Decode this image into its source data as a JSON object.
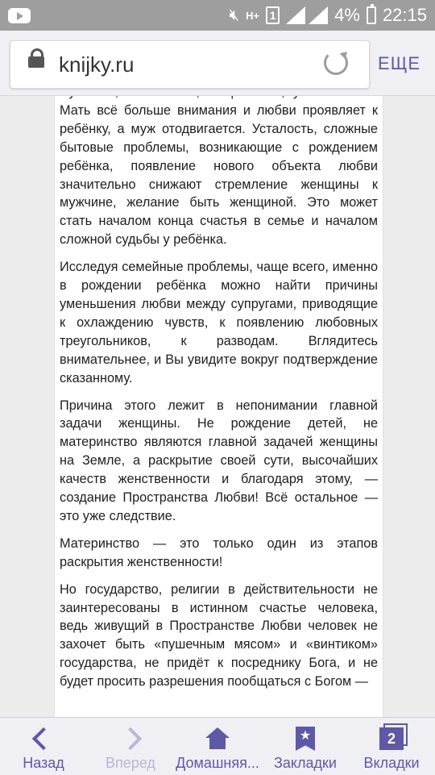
{
  "status_bar": {
    "battery": "4%",
    "time": "22:15",
    "network": "H+",
    "sim": "1"
  },
  "browser": {
    "url": "knijky.ru",
    "more_label": "ЕЩЕ"
  },
  "article": {
    "paragraphs": [
      "мужчины, но любовь, чаще всего, уменьшается. Мать всё больше внимания и любви проявляет к ребёнку, а муж отодвигается. Усталость, сложные бытовые проблемы, возникающие с рождением ребёнка, появление нового объекта любви значительно снижают стремление женщины к мужчине, желание быть женщиной. Это может стать началом конца счастья в семье и началом сложной судьбы у ребёнка.",
      "Исследуя семейные проблемы, чаще всего, именно в рождении ребёнка можно найти причины уменьшения любви между супругами, приводящие к охлаждению чувств, к появлению любовных треугольников, к разводам. Вглядитесь внимательнее, и Вы увидите вокруг подтверждение сказанному.",
      "Причина этого лежит в непонимании главной задачи женщины. Не рождение детей, не материнство являются главной задачей женщины на Земле, а раскрытие своей сути, высочайших качеств женственности и благодаря этому, — создание Пространства Любви! Всё остальное — это уже следствие.",
      "Материнство — это только один из этапов раскрытия женственности!",
      "Но государство, религии в действительности не заинтересованы в истинном счастье человека, ведь живущий в Пространстве Любви человек не захочет быть «пушечным мясом» и «винтиком» государства, не придёт к посреднику Бога, и не будет просить разрешения пообщаться с Богом —"
    ]
  },
  "bottom_nav": {
    "back": "Назад",
    "forward": "Вперед",
    "home": "Домашняя...",
    "bookmarks": "Закладки",
    "tabs": "Вкладки",
    "tab_count": "2"
  }
}
